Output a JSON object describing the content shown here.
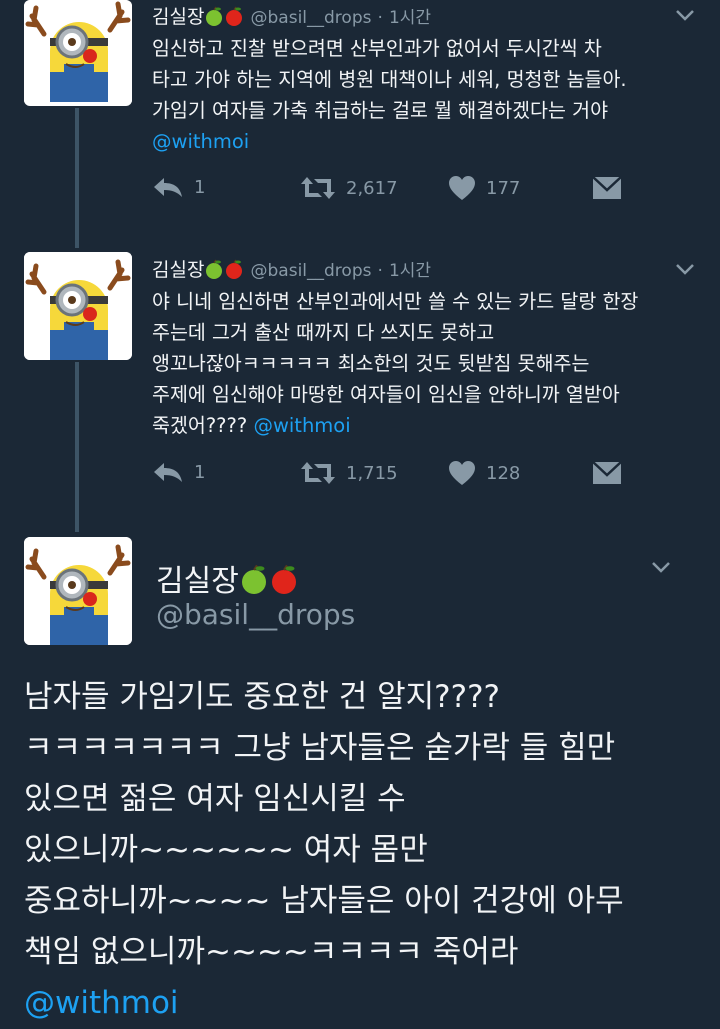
{
  "tweets": [
    {
      "name": "김실장",
      "handle": "@basil__drops",
      "time": "1시간",
      "lines": [
        "임신하고 진찰 받으려면 산부인과가 없어서 두시간씩 차",
        "타고 가야 하는 지역에 병원 대책이나 세워, 멍청한 놈들아.",
        "가임기 여자들 가축 취급하는 걸로 뭘 해결하겠다는 거야"
      ],
      "mention": "@withmoi",
      "replies": "1",
      "retweets": "2,617",
      "likes": "177"
    },
    {
      "name": "김실장",
      "handle": "@basil__drops",
      "time": "1시간",
      "lines": [
        "야 니네 임신하면 산부인과에서만 쓸 수 있는 카드 달랑 한장",
        "주는데 그거 출산 때까지 다 쓰지도 못하고",
        "앵꼬나잖아ㅋㅋㅋㅋㅋ 최소한의 것도 뒷받침 못해주는",
        "주제에 임신해야 마땅한 여자들이 임신을 안하니까 열받아"
      ],
      "last_line": "죽겠어????",
      "mention": "@withmoi",
      "replies": "1",
      "retweets": "1,715",
      "likes": "128"
    }
  ],
  "main_tweet": {
    "name": "김실장",
    "handle": "@basil__drops",
    "lines": [
      "남자들 가임기도 중요한 건 알지????",
      "ㅋㅋㅋㅋㅋㅋㅋ 그냥 남자들은 숟가락 들 힘만",
      "있으면 젊은 여자 임신시킬 수",
      "있으니까~~~~~~ 여자 몸만",
      "중요하니까~~~~ 남자들은 아이 건강에 아무",
      "책임 없으니까~~~~ㅋㅋㅋㅋ 죽어라"
    ],
    "mention": "@withmoi"
  },
  "colors": {
    "background": "#1b2836",
    "text": "#f2f4f6",
    "secondary": "#8899a6",
    "link": "#1da1f2"
  },
  "icons": [
    "green-apple-emoji",
    "red-apple-emoji",
    "reply-icon",
    "retweet-icon",
    "heart-icon",
    "direct-message-icon",
    "chevron-down-icon"
  ]
}
